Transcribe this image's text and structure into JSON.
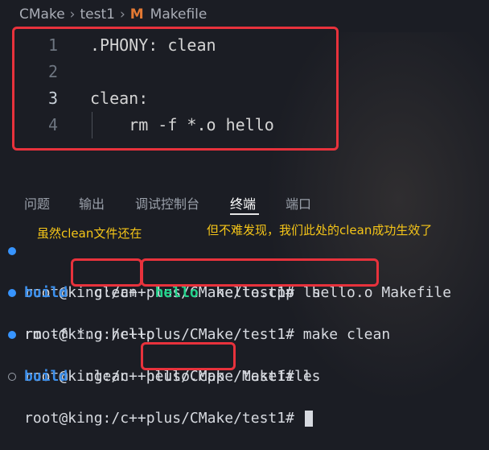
{
  "breadcrumb": {
    "root": "CMake",
    "folder": "test1",
    "file": "Makefile",
    "file_icon": "M"
  },
  "editor": {
    "lines": [
      {
        "num": "1",
        "text": ".PHONY: clean"
      },
      {
        "num": "2",
        "text": ""
      },
      {
        "num": "3",
        "text": "clean:"
      },
      {
        "num": "4",
        "text": "    rm -f *.o hello"
      }
    ]
  },
  "panel": {
    "tabs": [
      "问题",
      "输出",
      "调试控制台",
      "终端",
      "端口"
    ],
    "active_tab": "终端"
  },
  "annotations": {
    "left": "虽然clean文件还在",
    "right": "但不难发现，我们此处的clean成功生效了"
  },
  "terminal": {
    "prompt": "root@king:/c++plus/CMake/test1#",
    "cmd1": "ls",
    "ls1": {
      "build": "build",
      "clean": "clean",
      "hello": "hello",
      "hello_cpp": "hello.cpp",
      "hello_o": "hello.o",
      "makefile": "Makefile"
    },
    "cmd2": "make clean",
    "output2": "rm -f *.o hello",
    "cmd3": "ls",
    "ls2": {
      "build": "build",
      "clean": "clean",
      "hello_cpp": "hello.cpp",
      "makefile": "Makefile"
    }
  },
  "colors": {
    "annotation": "#f5c518",
    "highlight_box": "#e8323c",
    "directory": "#3b8eea",
    "executable": "#23d18b"
  }
}
